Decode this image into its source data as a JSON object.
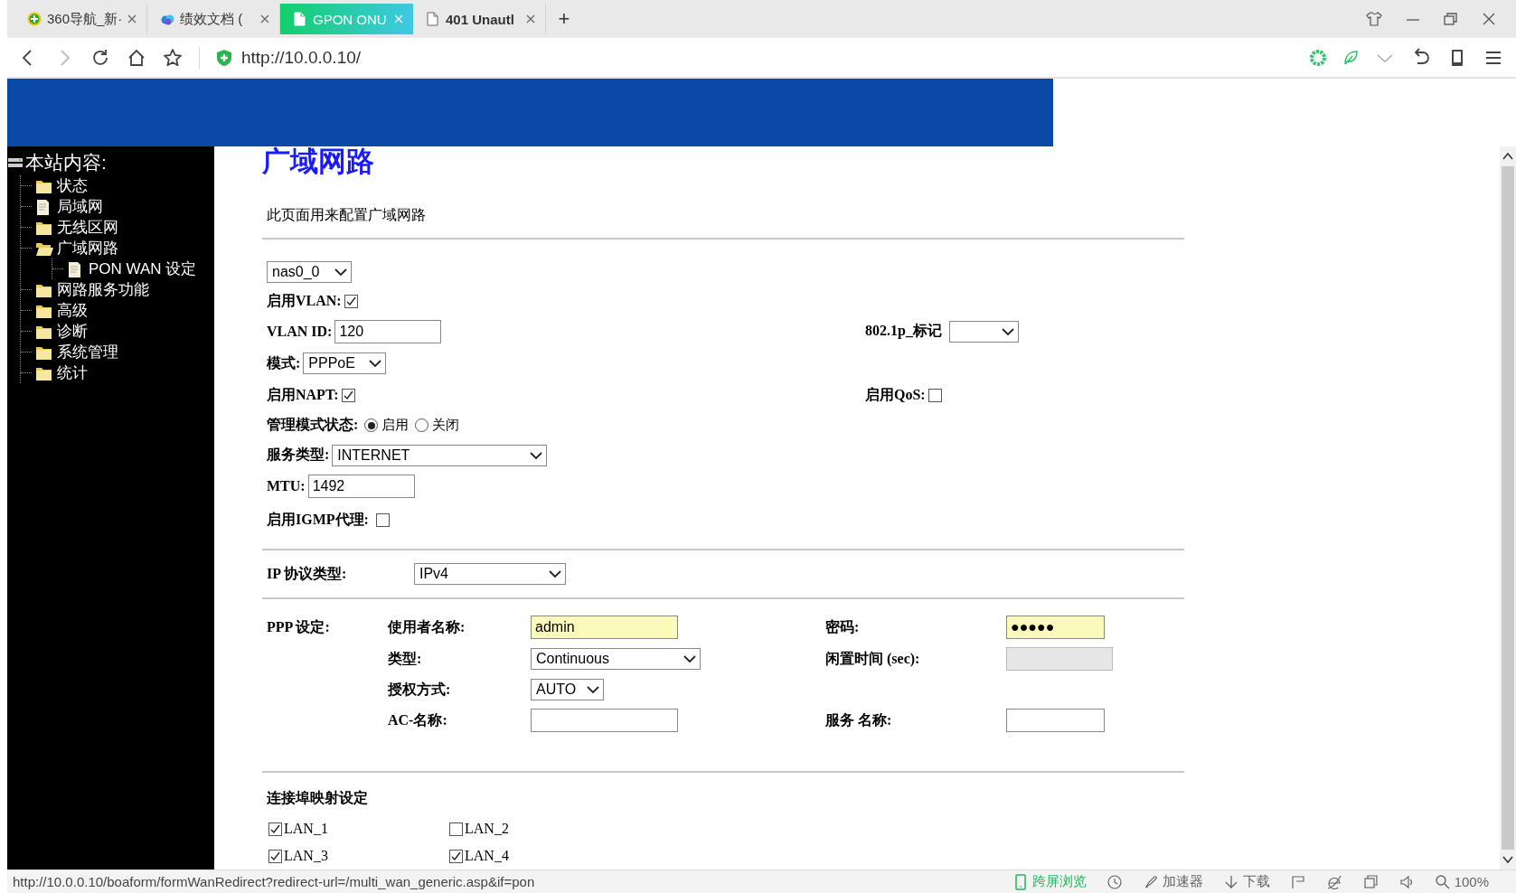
{
  "browser": {
    "tabs": [
      {
        "label": "360导航_新·",
        "selected": false
      },
      {
        "label": "绩效文档 (",
        "selected": false
      },
      {
        "label": "GPON ONU",
        "selected": true
      },
      {
        "label": "401 Unautl",
        "selected": false
      }
    ],
    "new_tab": "+",
    "url": "http://10.0.0.10/"
  },
  "sidebar": {
    "title": "本站内容:",
    "items": [
      {
        "label": "状态",
        "kind": "folder"
      },
      {
        "label": "局域网",
        "kind": "page"
      },
      {
        "label": "无线区网",
        "kind": "folder"
      },
      {
        "label": "广域网路",
        "kind": "folder-open",
        "children": [
          {
            "label": "PON WAN 设定",
            "kind": "page"
          }
        ]
      },
      {
        "label": "网路服务功能",
        "kind": "folder"
      },
      {
        "label": "高级",
        "kind": "folder"
      },
      {
        "label": "诊断",
        "kind": "folder"
      },
      {
        "label": "系统管理",
        "kind": "folder"
      },
      {
        "label": "统计",
        "kind": "folder"
      }
    ]
  },
  "form": {
    "title": "广域网路",
    "description": "此页面用来配置广域网路",
    "interface": "nas0_0",
    "vlan_enable": {
      "label": "启用VLAN:",
      "checked": true
    },
    "vlan_id": {
      "label": "VLAN ID:",
      "value": "120"
    },
    "priority": {
      "label": "802.1p_标记"
    },
    "mode": {
      "label": "模式:",
      "value": "PPPoE"
    },
    "napt": {
      "label": "启用NAPT:",
      "checked": true
    },
    "qos": {
      "label": "启用QoS:",
      "checked": false
    },
    "admin_state": {
      "label": "管理模式状态:",
      "options": [
        {
          "label": "启用",
          "selected": true
        },
        {
          "label": "关闭",
          "selected": false
        }
      ]
    },
    "service_type": {
      "label": "服务类型:",
      "value": "INTERNET"
    },
    "mtu": {
      "label": "MTU:",
      "value": "1492"
    },
    "igmp": {
      "label": "启用IGMP代理:",
      "checked": false
    },
    "ip_protocol": {
      "label": "IP 协议类型:",
      "value": "IPv4"
    },
    "ppp": {
      "heading": "PPP 设定:",
      "rows": [
        {
          "cells": [
            {
              "label": "使用者名称:",
              "kind": "text",
              "value": "admin",
              "autofilled": true
            },
            {
              "label": "密码:",
              "kind": "text",
              "value": "●●●●●",
              "autofilled": true
            }
          ]
        },
        {
          "cells": [
            {
              "label": "类型:",
              "kind": "select",
              "value": "Continuous"
            },
            {
              "label": "闲置时间 (sec):",
              "kind": "text",
              "disabled": true
            }
          ]
        },
        {
          "cells": [
            {
              "label": "授权方式:",
              "kind": "select",
              "value": "AUTO"
            }
          ]
        },
        {
          "cells": [
            {
              "label": "AC-名称:",
              "kind": "text"
            },
            {
              "label": "服务 名称:",
              "kind": "text"
            }
          ]
        }
      ]
    },
    "port_mapping": {
      "heading": "连接埠映射设定",
      "ports": [
        {
          "label": "LAN_1",
          "checked": true
        },
        {
          "label": "LAN_2",
          "checked": false
        },
        {
          "label": "LAN_3",
          "checked": true
        },
        {
          "label": "LAN_4",
          "checked": true
        }
      ]
    }
  },
  "status_bar": {
    "url": "http://10.0.0.10/boaform/formWanRedirect?redirect-url=/multi_wan_generic.asp&if=pon",
    "items": [
      "跨屏浏览",
      "加速器",
      "下载",
      "100%"
    ]
  }
}
